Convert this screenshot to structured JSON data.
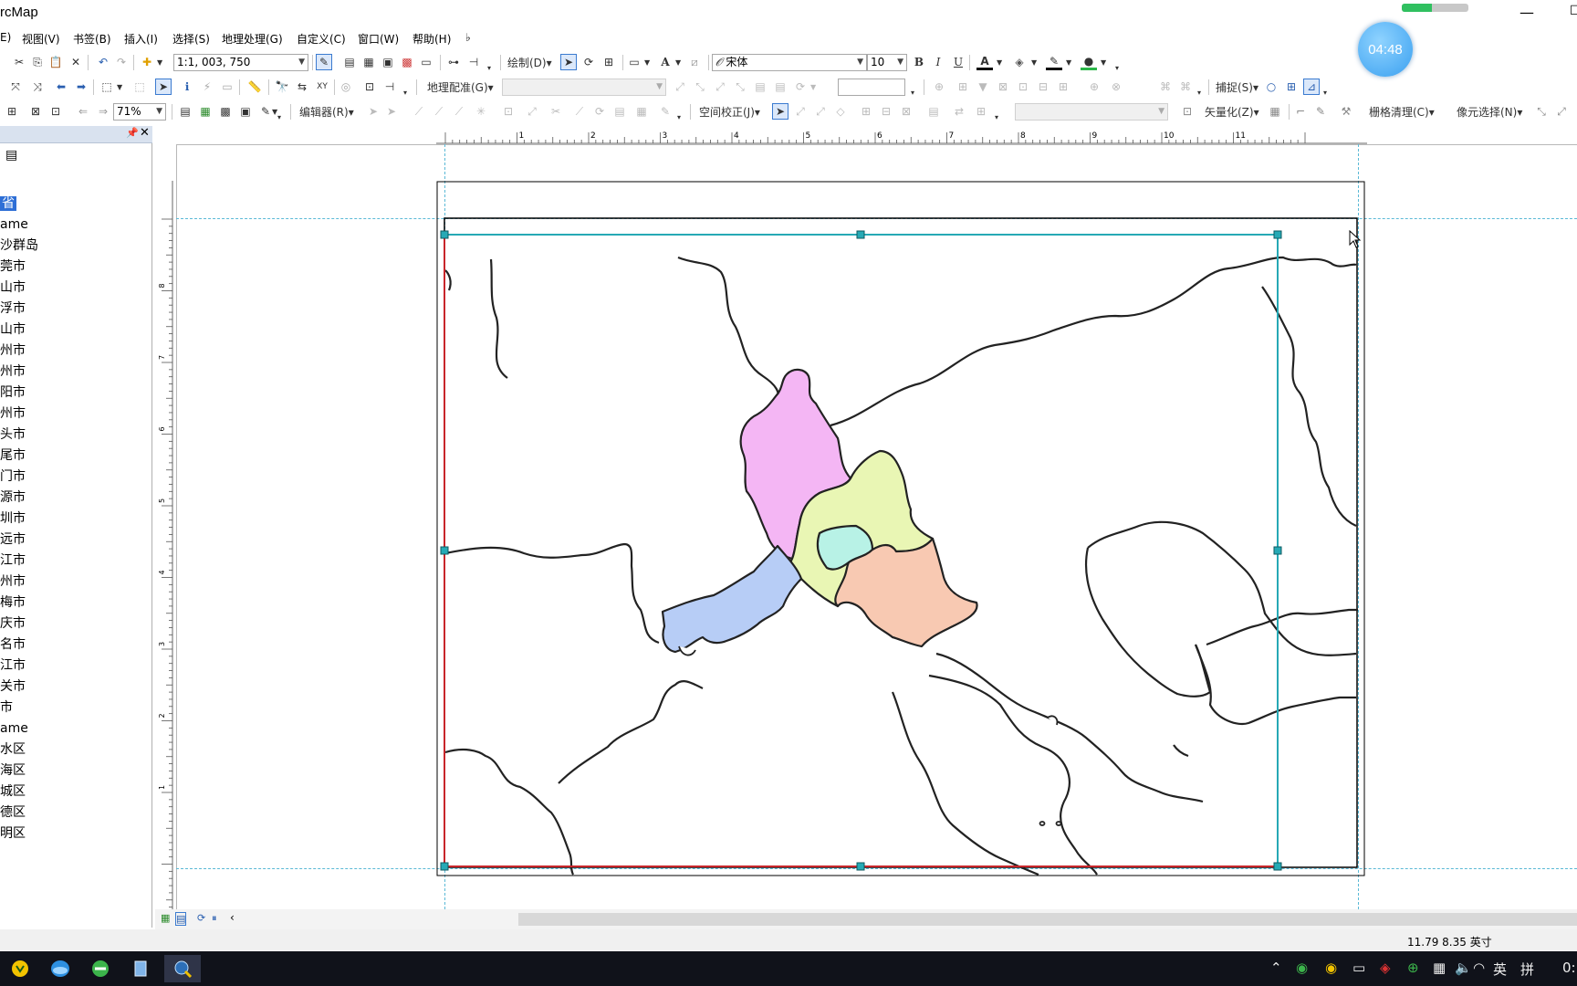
{
  "app": {
    "title": "ArcMap",
    "title_visible": "rcMap",
    "clock_widget": "04:48",
    "progress_fraction": 0.45
  },
  "menu": [
    {
      "label": "E)",
      "name": "menu-edit"
    },
    {
      "label": "视图(V)",
      "name": "menu-view"
    },
    {
      "label": "书签(B)",
      "name": "menu-bookmarks"
    },
    {
      "label": "插入(I)",
      "name": "menu-insert"
    },
    {
      "label": "选择(S)",
      "name": "menu-selection"
    },
    {
      "label": "地理处理(G)",
      "name": "menu-geoprocessing"
    },
    {
      "label": "自定义(C)",
      "name": "menu-customize"
    },
    {
      "label": "窗口(W)",
      "name": "menu-windows"
    },
    {
      "label": "帮助(H)",
      "name": "menu-help"
    }
  ],
  "toolbar": {
    "scale": "1:1, 003, 750",
    "draw_menu": "绘制(D)",
    "font_name": "宋体",
    "font_size": "10",
    "bold": "B",
    "italic": "I",
    "underline": "U",
    "font_color_glyph": "A",
    "georef_menu": "地理配准(G)",
    "snapping_menu": "捕捉(S)",
    "zoom_percent": "71%",
    "editor_menu": "编辑器(R)",
    "spatial_adjust_menu": "空间校正(J)",
    "vectorize_menu": "矢量化(Z)",
    "raster_cleanup_menu": "栅格清理(C)",
    "cell_select_menu": "像元选择(N)"
  },
  "toc": {
    "items": [
      {
        "label": "省",
        "selected": true
      },
      {
        "label": "ame"
      },
      {
        "label": "沙群岛"
      },
      {
        "label": "莞市"
      },
      {
        "label": "山市"
      },
      {
        "label": "浮市"
      },
      {
        "label": "山市"
      },
      {
        "label": "州市"
      },
      {
        "label": "州市"
      },
      {
        "label": "阳市"
      },
      {
        "label": "州市"
      },
      {
        "label": "头市"
      },
      {
        "label": "尾市"
      },
      {
        "label": "门市"
      },
      {
        "label": "源市"
      },
      {
        "label": "圳市"
      },
      {
        "label": "远市"
      },
      {
        "label": "江市"
      },
      {
        "label": "州市"
      },
      {
        "label": "梅市"
      },
      {
        "label": "庆市"
      },
      {
        "label": "名市"
      },
      {
        "label": "江市"
      },
      {
        "label": "关市"
      },
      {
        "label": "市"
      },
      {
        "label": "ame"
      },
      {
        "label": "水区"
      },
      {
        "label": "海区"
      },
      {
        "label": "城区"
      },
      {
        "label": "德区"
      },
      {
        "label": "明区"
      }
    ]
  },
  "rulers": {
    "horizontal_ticks": [
      "1",
      "2",
      "3",
      "4",
      "5",
      "6",
      "7",
      "8",
      "9",
      "10",
      "11"
    ],
    "vertical_ticks": [
      "8",
      "7",
      "6",
      "5",
      "4",
      "3",
      "2",
      "1"
    ]
  },
  "map": {
    "colors": {
      "pink_region": "#f4b6f4",
      "yellow_region": "#e9f6b4",
      "cyan_region": "#b8f2e6",
      "peach_region": "#f8c9b2",
      "blue_region": "#b7cdf6",
      "selection": "#26a9b5",
      "frame_red": "#c8262b"
    }
  },
  "status": {
    "coords": "11.79  8.35 英寸"
  },
  "taskbar": {
    "ime_lang": "英",
    "ime_mode": "拼",
    "time_partial": "0:"
  }
}
